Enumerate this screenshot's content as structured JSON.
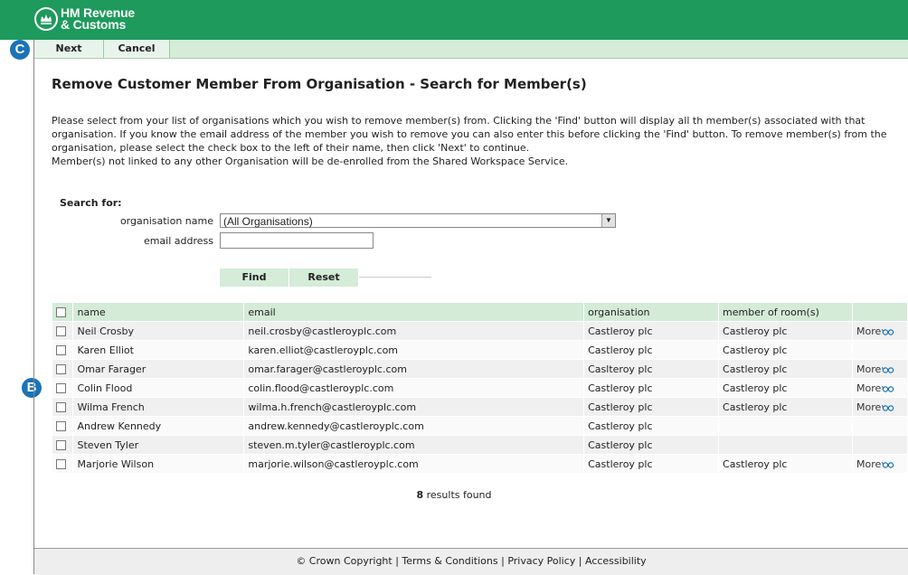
{
  "header": {
    "logo_line1": "HM Revenue",
    "logo_line2": "& Customs"
  },
  "toolbar": {
    "next_label": "Next",
    "cancel_label": "Cancel"
  },
  "badges": {
    "c": "C",
    "b": "B"
  },
  "page_title": "Remove Customer Member From Organisation - Search for Member(s)",
  "intro": {
    "line1": "Please select from your list of organisations which you wish to remove member(s) from. Clicking the 'Find' button will display all th member(s) associated with that",
    "line2": "organisation. If you know the email address of the member you wish to remove you can also enter this before clicking the 'Find' button. To remove member(s) from the",
    "line3": "organisation, please select the check box to the left of their name, then click 'Next' to continue.",
    "line4": "Member(s) not linked to any other Organisation will be de-enrolled from the Shared Workspace Service."
  },
  "search": {
    "heading": "Search for:",
    "org_label": "organisation name",
    "org_value": "(All Organisations)",
    "email_label": "email address",
    "email_value": "",
    "find_label": "Find",
    "reset_label": "Reset"
  },
  "table": {
    "columns": {
      "name": "name",
      "email": "email",
      "organisation": "organisation",
      "rooms": "member of room(s)"
    },
    "more_label": "More",
    "rows": [
      {
        "name": "Neil Crosby",
        "email": "neil.crosby@castleroyplc.com",
        "organisation": "Castleroy plc",
        "rooms": "Castleroy plc",
        "more": "More"
      },
      {
        "name": "Karen Elliot",
        "email": "karen.elliot@castleroyplc.com",
        "organisation": "Castleroy plc",
        "rooms": "Castleroy plc",
        "more": ""
      },
      {
        "name": "Omar Farager",
        "email": "omar.farager@castleroyplc.com",
        "organisation": "Caslteroy plc",
        "rooms": "Castleroy plc",
        "more": "More"
      },
      {
        "name": "Colin Flood",
        "email": "colin.flood@castleroyplc.com",
        "organisation": "Castleroy plc",
        "rooms": "Castleroy plc",
        "more": "More"
      },
      {
        "name": "Wilma French",
        "email": "wilma.h.french@castleroyplc.com",
        "organisation": "Castleroy plc",
        "rooms": "Castleroy plc",
        "more": "More"
      },
      {
        "name": "Andrew Kennedy",
        "email": "andrew.kennedy@castleroyplc.com",
        "organisation": "Castleroy plc",
        "rooms": "",
        "more": ""
      },
      {
        "name": "Steven Tyler",
        "email": "steven.m.tyler@castleroyplc.com",
        "organisation": "Castleroy plc",
        "rooms": "",
        "more": ""
      },
      {
        "name": "Marjorie Wilson",
        "email": "marjorie.wilson@castleroyplc.com",
        "organisation": "Castleroy plc",
        "rooms": "Castleroy plc",
        "more": "More"
      }
    ]
  },
  "results": {
    "count": "8",
    "suffix": " results found"
  },
  "footer": {
    "copyright": "© Crown Copyright",
    "sep": " | ",
    "terms": "Terms & Conditions",
    "privacy": "Privacy Policy",
    "accessibility": "Accessibility"
  },
  "colors": {
    "header_green": "#1d9a5c",
    "toolbar_green": "#d4ecd8",
    "badge_blue": "#1b73b6"
  }
}
